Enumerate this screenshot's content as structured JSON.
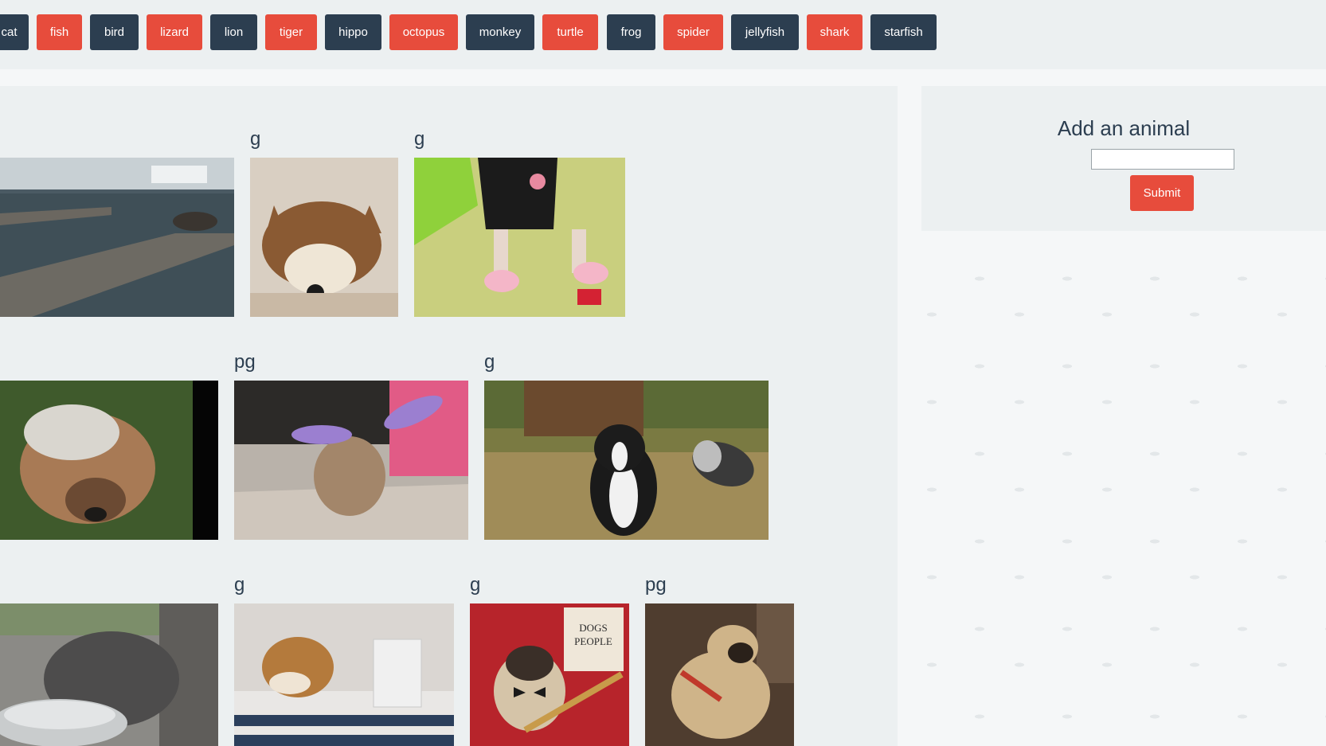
{
  "topbar": {
    "buttons": [
      {
        "label": "cat",
        "color": "dark"
      },
      {
        "label": "fish",
        "color": "red"
      },
      {
        "label": "bird",
        "color": "dark"
      },
      {
        "label": "lizard",
        "color": "red"
      },
      {
        "label": "lion",
        "color": "dark"
      },
      {
        "label": "tiger",
        "color": "red"
      },
      {
        "label": "hippo",
        "color": "dark"
      },
      {
        "label": "octopus",
        "color": "red"
      },
      {
        "label": "monkey",
        "color": "dark"
      },
      {
        "label": "turtle",
        "color": "red"
      },
      {
        "label": "frog",
        "color": "dark"
      },
      {
        "label": "spider",
        "color": "red"
      },
      {
        "label": "jellyfish",
        "color": "dark"
      },
      {
        "label": "shark",
        "color": "red"
      },
      {
        "label": "starfish",
        "color": "dark"
      }
    ]
  },
  "gallery": {
    "row1": {
      "ratings": [
        "g",
        "g"
      ],
      "images": [
        "dock-water-gif",
        "fluffy-dog-plush-gif",
        "dog-in-pink-boots-gif"
      ]
    },
    "row2": {
      "ratings": [
        "pg",
        "g"
      ],
      "images": [
        "bulldog-in-grass-gif",
        "puppy-with-wings-gif",
        "boston-terrier-microphone-gif"
      ]
    },
    "row3": {
      "ratings": [
        "g",
        "g",
        "pg"
      ],
      "images": [
        "french-bulldog-bowl-gif",
        "shiba-laptop-gif",
        "pug-dogs-people-book-gif",
        "pug-on-couch-gif"
      ]
    }
  },
  "sidepanel": {
    "title": "Add an animal",
    "input_value": "",
    "submit_label": "Submit"
  },
  "colors": {
    "dark_button": "#2c3e50",
    "red_button": "#e74c3c",
    "panel_bg": "#ecf0f1",
    "text": "#2c3e50"
  }
}
